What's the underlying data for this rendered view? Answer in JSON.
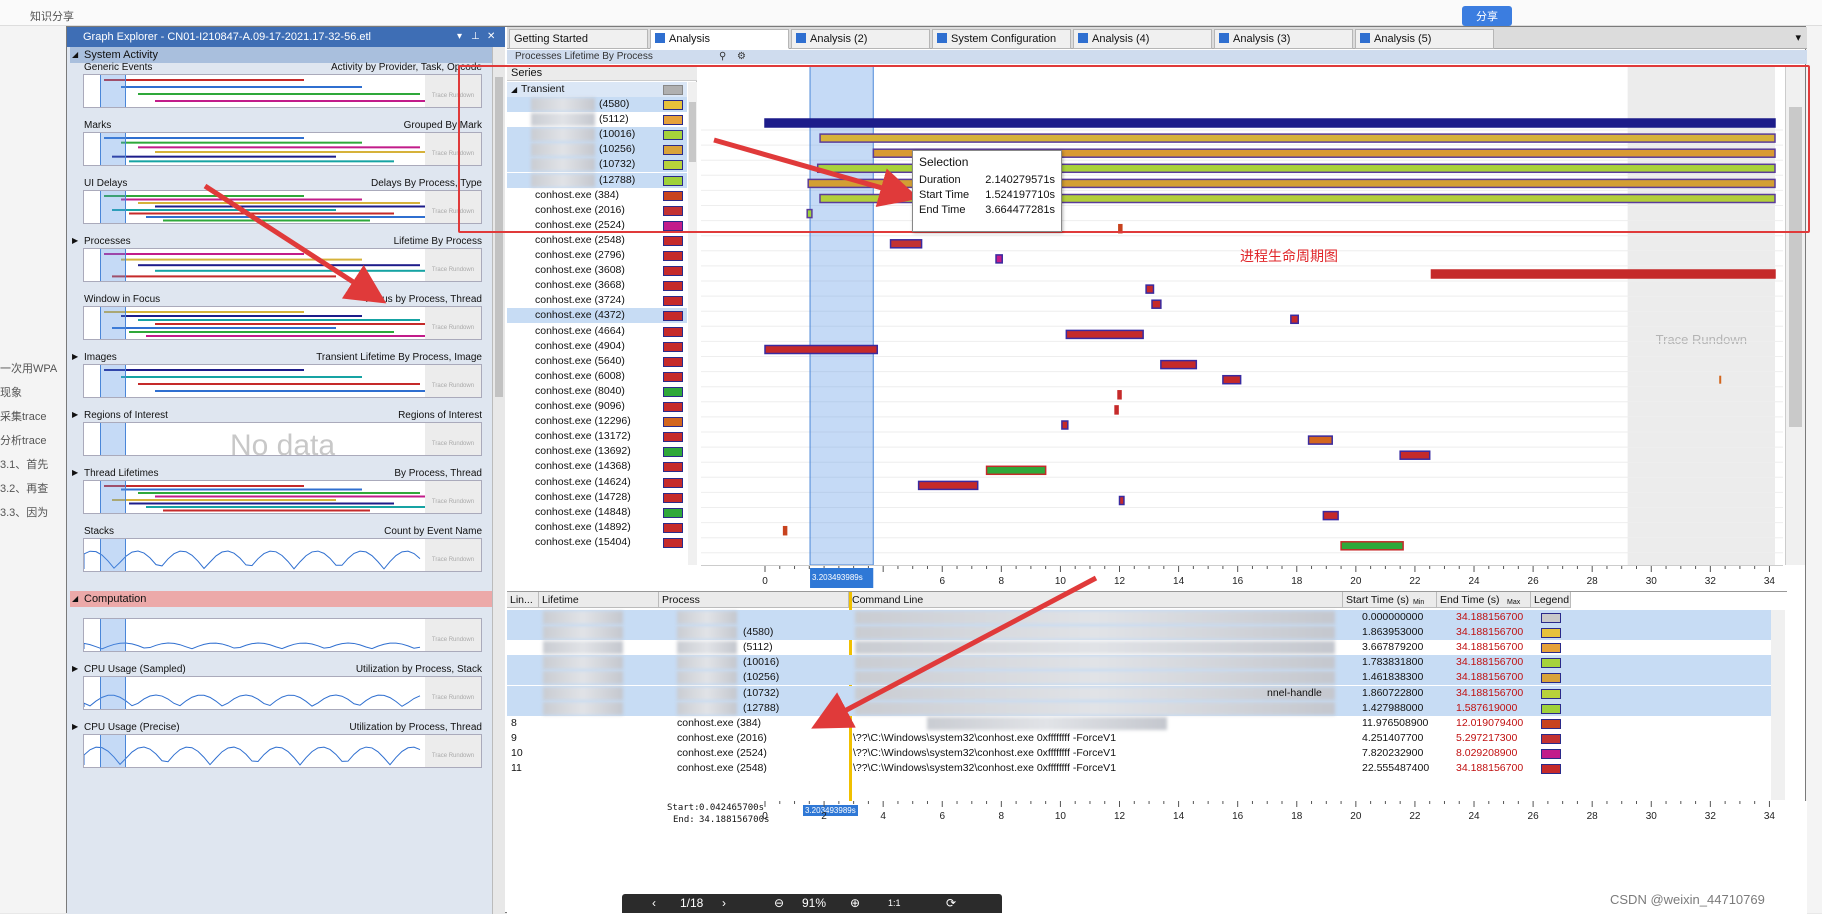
{
  "background": {
    "top_left": "知识分享",
    "top_right": "分享",
    "left_lines": [
      "一次用WPA",
      "现象",
      "采集trace",
      "分析trace",
      "3.1、首先",
      "3.2、再查",
      "3.3、因为"
    ]
  },
  "graph_explorer": {
    "title": "Graph Explorer - CN01-I210847-A.09-17-2021.17-32-56.etl",
    "sections": [
      {
        "header": "System Activity",
        "color": "blue",
        "graphs": [
          {
            "label": "Generic Events",
            "right": "Activity by Provider, Task, Opcode"
          },
          {
            "label": "Marks",
            "right": "Grouped By Mark"
          },
          {
            "label": "UI Delays",
            "right": "Delays By Process, Type"
          },
          {
            "label": "Processes",
            "right": "Lifetime By Process",
            "expander": true
          },
          {
            "label": "Window in Focus",
            "right": "Focus by Process, Thread"
          },
          {
            "label": "Images",
            "right": "Transient Lifetime By Process, Image",
            "expander": true
          },
          {
            "label": "Regions of Interest",
            "right": "Regions of Interest",
            "expander": true,
            "nodata": "No data"
          },
          {
            "label": "Thread Lifetimes",
            "right": "By Process, Thread",
            "expander": true
          },
          {
            "label": "Stacks",
            "right": "Count by Event Name"
          }
        ]
      },
      {
        "header": "Computation",
        "color": "red",
        "graphs": [
          {
            "label": "",
            "right": ""
          },
          {
            "label": "CPU Usage (Sampled)",
            "right": "Utilization by Process, Stack",
            "expander": true
          },
          {
            "label": "CPU Usage (Precise)",
            "right": "Utilization by Process, Thread",
            "expander": true
          }
        ]
      }
    ],
    "rundown_label": "Trace Rundown"
  },
  "tabs": [
    {
      "label": "Getting Started",
      "icon": false,
      "active": false
    },
    {
      "label": "Analysis",
      "icon": true,
      "active": true
    },
    {
      "label": "Analysis (2)",
      "icon": true,
      "active": false
    },
    {
      "label": "System Configuration",
      "icon": true,
      "active": false
    },
    {
      "label": "Analysis (4)",
      "icon": true,
      "active": false
    },
    {
      "label": "Analysis (3)",
      "icon": true,
      "active": false
    },
    {
      "label": "Analysis (5)",
      "icon": true,
      "active": false
    }
  ],
  "graph_title": "Processes  Lifetime By Process",
  "series_panel": {
    "header": "Series",
    "group": "Transient",
    "rows": [
      {
        "name": "(4580)",
        "color": "#e7c23a",
        "hl": true,
        "blur": true
      },
      {
        "name": "(5112)",
        "color": "#e6a13a",
        "hl": false,
        "blur": true
      },
      {
        "name": "(10016)",
        "color": "#a6d23a",
        "hl": true,
        "blur": true
      },
      {
        "name": "(10256)",
        "color": "#d9a33a",
        "hl": true,
        "blur": true
      },
      {
        "name": "(10732)",
        "color": "#b8d23a",
        "hl": true,
        "blur": true
      },
      {
        "name": "(12788)",
        "color": "#9fd13a",
        "hl": true,
        "blur": true
      },
      {
        "name": "conhost.exe (384)",
        "color": "#c8431e",
        "hl": false
      },
      {
        "name": "conhost.exe (2016)",
        "color": "#c23232",
        "hl": false
      },
      {
        "name": "conhost.exe (2524)",
        "color": "#c21c8a",
        "hl": false
      },
      {
        "name": "conhost.exe (2548)",
        "color": "#c52a2a",
        "hl": false
      },
      {
        "name": "conhost.exe (2796)",
        "color": "#c52a2a",
        "hl": false
      },
      {
        "name": "conhost.exe (3608)",
        "color": "#c52a2a",
        "hl": false
      },
      {
        "name": "conhost.exe (3668)",
        "color": "#c52a2a",
        "hl": false
      },
      {
        "name": "conhost.exe (3724)",
        "color": "#c52a2a",
        "hl": false
      },
      {
        "name": "conhost.exe (4372)",
        "color": "#c52a2a",
        "hl": true
      },
      {
        "name": "conhost.exe (4664)",
        "color": "#c52a2a",
        "hl": false
      },
      {
        "name": "conhost.exe (4904)",
        "color": "#c52a2a",
        "hl": false
      },
      {
        "name": "conhost.exe (5640)",
        "color": "#c52a2a",
        "hl": false
      },
      {
        "name": "conhost.exe (6008)",
        "color": "#c52a2a",
        "hl": false
      },
      {
        "name": "conhost.exe (8040)",
        "color": "#2fa83a",
        "hl": false
      },
      {
        "name": "conhost.exe (9096)",
        "color": "#c52a2a",
        "hl": false
      },
      {
        "name": "conhost.exe (12296)",
        "color": "#d3661e",
        "hl": false
      },
      {
        "name": "conhost.exe (13172)",
        "color": "#c52a2a",
        "hl": false
      },
      {
        "name": "conhost.exe (13692)",
        "color": "#2fa83a",
        "hl": false
      },
      {
        "name": "conhost.exe (14368)",
        "color": "#c52a2a",
        "hl": false
      },
      {
        "name": "conhost.exe (14624)",
        "color": "#c52a2a",
        "hl": false
      },
      {
        "name": "conhost.exe (14728)",
        "color": "#c52a2a",
        "hl": false
      },
      {
        "name": "conhost.exe (14848)",
        "color": "#2fa83a",
        "hl": false
      },
      {
        "name": "conhost.exe (14892)",
        "color": "#c52a2a",
        "hl": false
      },
      {
        "name": "conhost.exe (15404)",
        "color": "#c52a2a",
        "hl": false
      }
    ]
  },
  "timeline": {
    "x_ticks": [
      "0",
      "2",
      "4",
      "6",
      "8",
      "10",
      "12",
      "14",
      "16",
      "18",
      "20",
      "22",
      "24",
      "26",
      "28",
      "30",
      "32",
      "34"
    ],
    "x_max": 34.188156,
    "selection_start": 1.52419771,
    "selection_end": 3.664477281,
    "selection_badge": "3.203493989s",
    "rundown_label": "Trace Rundown",
    "rundown_start": 29.2,
    "rows": [
      {
        "start": 0.0,
        "end": 34.188,
        "color": "#1d1c8a",
        "outline": "#1d1c8a"
      },
      {
        "start": 1.864,
        "end": 34.188,
        "color": "#d6b23a",
        "outline": "#5a3c9a"
      },
      {
        "start": 3.668,
        "end": 34.188,
        "color": "#d99a33",
        "outline": "#5a3c9a"
      },
      {
        "start": 1.784,
        "end": 34.188,
        "color": "#a9d23a",
        "outline": "#5a3c9a"
      },
      {
        "start": 1.462,
        "end": 34.188,
        "color": "#d39f33",
        "outline": "#5a3c9a"
      },
      {
        "start": 1.861,
        "end": 34.188,
        "color": "#b3cf3a",
        "outline": "#5a3c9a"
      },
      {
        "start": 1.428,
        "end": 1.588,
        "color": "#9fd13a",
        "outline": "#5a3c9a"
      },
      {
        "start": 11.977,
        "end": 12.02,
        "color": "#c8431e",
        "outline": "#c8431e"
      },
      {
        "start": 4.25,
        "end": 5.3,
        "color": "#c23232",
        "outline": "#3a2aa0"
      },
      {
        "start": 7.82,
        "end": 8.03,
        "color": "#c21c8a",
        "outline": "#3a2aa0"
      },
      {
        "start": 22.56,
        "end": 34.188,
        "color": "#c52a2a",
        "outline": "#c52a2a"
      },
      {
        "start": 12.9,
        "end": 13.15,
        "color": "#c52a2a",
        "outline": "#3a2aa0"
      },
      {
        "start": 13.1,
        "end": 13.4,
        "color": "#c52a2a",
        "outline": "#3a2aa0"
      },
      {
        "start": 17.8,
        "end": 18.05,
        "color": "#c52a2a",
        "outline": "#3a2aa0"
      },
      {
        "start": 10.2,
        "end": 12.8,
        "color": "#c52a2a",
        "outline": "#3a2aa0"
      },
      {
        "start": 0.0,
        "end": 3.8,
        "color": "#c52a2a",
        "outline": "#3a2aa0"
      },
      {
        "start": 13.4,
        "end": 14.6,
        "color": "#c52a2a",
        "outline": "#3a2aa0"
      },
      {
        "start": 15.5,
        "end": 16.1,
        "color": "#c52a2a",
        "outline": "#3a2aa0"
      },
      {
        "start": 11.95,
        "end": 12.02,
        "color": "#c52a2a",
        "outline": "#c52a2a"
      },
      {
        "start": 11.85,
        "end": 11.92,
        "color": "#c52a2a",
        "outline": "#c52a2a"
      },
      {
        "start": 10.05,
        "end": 10.25,
        "color": "#c52a2a",
        "outline": "#3a2aa0"
      },
      {
        "start": 18.4,
        "end": 19.2,
        "color": "#d3661e",
        "outline": "#3a2aa0"
      },
      {
        "start": 21.5,
        "end": 22.5,
        "color": "#c52a2a",
        "outline": "#3a2aa0"
      },
      {
        "start": 7.5,
        "end": 9.5,
        "color": "#2fa83a",
        "outline": "#c52a2a"
      },
      {
        "start": 5.2,
        "end": 7.2,
        "color": "#c52a2a",
        "outline": "#3a2aa0"
      },
      {
        "start": 12.0,
        "end": 12.15,
        "color": "#c52a2a",
        "outline": "#3a2aa0"
      },
      {
        "start": 18.9,
        "end": 19.4,
        "color": "#c52a2a",
        "outline": "#3a2aa0"
      },
      {
        "start": 0.63,
        "end": 0.67,
        "color": "#c8431e",
        "outline": "#c8431e"
      },
      {
        "start": 19.5,
        "end": 21.6,
        "color": "#2fa83a",
        "outline": "#c52a2a"
      },
      {
        "start": 0.0,
        "end": 0.0,
        "color": "#c52a2a",
        "outline": "#c52a2a"
      }
    ],
    "extra_marks": [
      {
        "row": 17,
        "start": 32.3,
        "end": 32.35,
        "color": "#d3661e"
      }
    ]
  },
  "tooltip": {
    "title": "Selection",
    "duration_label": "Duration",
    "duration": "2.140279571s",
    "start_label": "Start Time",
    "start": "1.524197710s",
    "end_label": "End Time",
    "end": "3.664477281s"
  },
  "table": {
    "headers": [
      "Lin...",
      "Lifetime",
      "Process",
      "Command Line",
      "Start Time (s)",
      "End Time (s)",
      "Legend"
    ],
    "min_label": "Min",
    "max_label": "Max",
    "rows": [
      {
        "line": "",
        "process": "",
        "cmd": "",
        "start": "0.000000000",
        "end": "34.188156700",
        "color": "#c9c9c9",
        "hl": true
      },
      {
        "line": "",
        "process": "(4580)",
        "cmd": "",
        "start": "1.863953000",
        "end": "34.188156700",
        "color": "#e7c23a",
        "hl": true
      },
      {
        "line": "",
        "process": "(5112)",
        "cmd": "",
        "start": "3.667879200",
        "end": "34.188156700",
        "color": "#e6a13a",
        "hl": false
      },
      {
        "line": "",
        "process": "(10016)",
        "cmd": "",
        "start": "1.783831800",
        "end": "34.188156700",
        "color": "#a6d23a",
        "hl": true
      },
      {
        "line": "",
        "process": "(10256)",
        "cmd": "",
        "start": "1.461838300",
        "end": "34.188156700",
        "color": "#d9a33a",
        "hl": true
      },
      {
        "line": "",
        "process": "(10732)",
        "cmd": "nnel-handle",
        "start": "1.860722800",
        "end": "34.188156700",
        "color": "#b8d23a",
        "hl": true
      },
      {
        "line": "",
        "process": "(12788)",
        "cmd": "",
        "start": "1.427988000",
        "end": "1.587619000",
        "color": "#9fd13a",
        "hl": true
      },
      {
        "line": "8",
        "process": "conhost.exe (384)",
        "cmd": "",
        "start": "11.976508900",
        "end": "12.019079400",
        "color": "#c8431e",
        "hl": false
      },
      {
        "line": "9",
        "process": "conhost.exe (2016)",
        "cmd": "\\??\\C:\\Windows\\system32\\conhost.exe 0xffffffff -ForceV1",
        "start": "4.251407700",
        "end": "5.297217300",
        "color": "#c23232",
        "hl": false
      },
      {
        "line": "10",
        "process": "conhost.exe (2524)",
        "cmd": "\\??\\C:\\Windows\\system32\\conhost.exe 0xffffffff -ForceV1",
        "start": "7.820232900",
        "end": "8.029208900",
        "color": "#c21c8a",
        "hl": false
      },
      {
        "line": "11",
        "process": "conhost.exe (2548)",
        "cmd": "\\??\\C:\\Windows\\system32\\conhost.exe 0xffffffff -ForceV1",
        "start": "22.555487400",
        "end": "34.188156700",
        "color": "#c52a2a",
        "hl": false
      }
    ]
  },
  "bottom": {
    "start_label": "Start:",
    "start_value": "0.042465700s",
    "end_label": "End:",
    "end_value": "34.188156700s",
    "badge": "3.203493989s"
  },
  "pager": {
    "page": "1/18",
    "zoom": "91%",
    "fit": "1:1"
  },
  "annotation": {
    "label": "进程生命周期图"
  },
  "watermark": "CSDN @weixin_44710769"
}
